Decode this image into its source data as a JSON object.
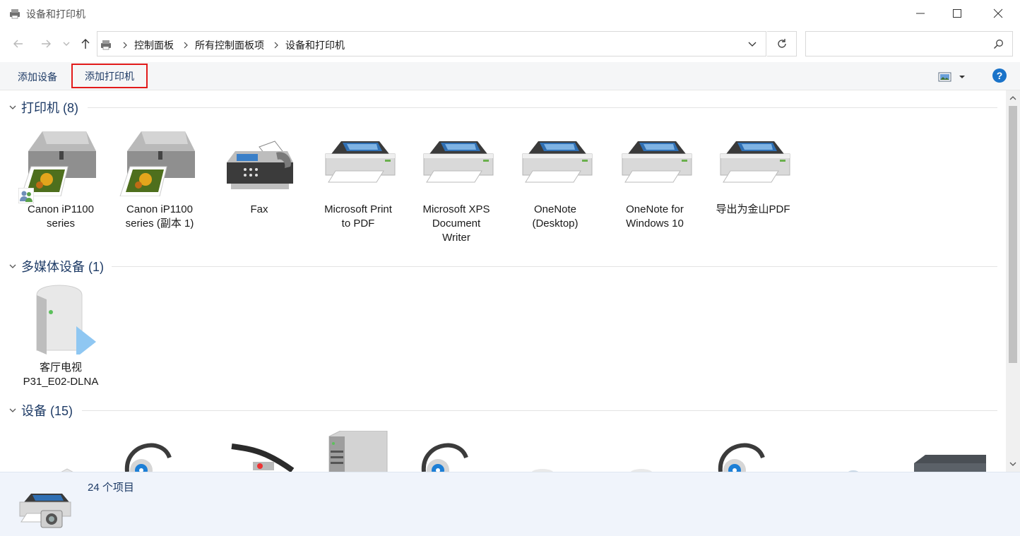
{
  "window": {
    "title": "设备和打印机"
  },
  "address": {
    "crumbs": [
      "控制面板",
      "所有控制面板项",
      "设备和打印机"
    ],
    "search_placeholder": ""
  },
  "commands": {
    "add_device": "添加设备",
    "add_printer": "添加打印机",
    "help": "?"
  },
  "groups": {
    "printers": {
      "title": "打印机 (8)",
      "items": [
        {
          "label": "Canon iP1100\nseries",
          "icon": "inkjet-printer-icon"
        },
        {
          "label": "Canon iP1100\nseries (副本 1)",
          "icon": "inkjet-printer-icon"
        },
        {
          "label": "Fax",
          "icon": "fax-icon"
        },
        {
          "label": "Microsoft Print\nto PDF",
          "icon": "printer-icon"
        },
        {
          "label": "Microsoft XPS\nDocument\nWriter",
          "icon": "printer-icon"
        },
        {
          "label": "OneNote\n(Desktop)",
          "icon": "printer-icon"
        },
        {
          "label": "OneNote for\nWindows 10",
          "icon": "printer-icon"
        },
        {
          "label": "导出为金山PDF",
          "icon": "printer-icon"
        }
      ]
    },
    "multimedia": {
      "title": "多媒体设备 (1)",
      "items": [
        {
          "label": "客厅电视\nP31_E02-DLNA",
          "icon": "media-server-icon"
        }
      ]
    },
    "devices": {
      "title": "设备 (15)"
    }
  },
  "details": {
    "count": "24 个项目"
  },
  "colors": {
    "accent": "#1e3b66",
    "highlight": "#e21b1b",
    "help": "#1a73c9"
  }
}
